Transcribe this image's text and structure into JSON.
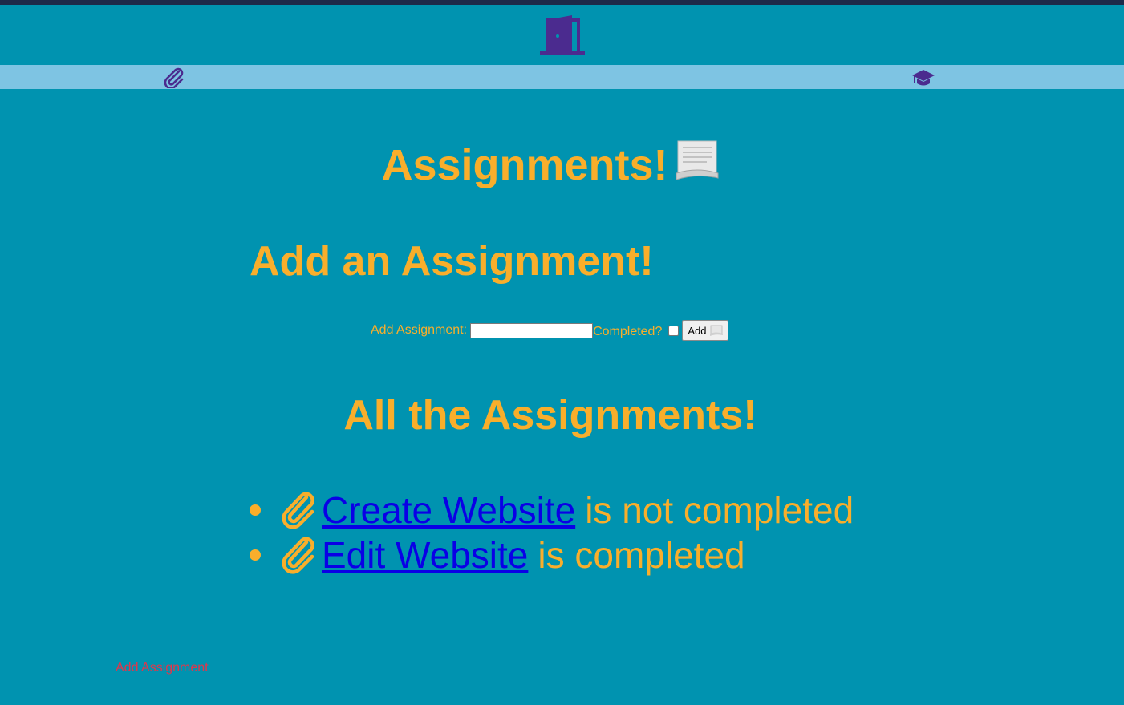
{
  "header": {
    "logout_icon": "door-icon"
  },
  "nav": {
    "left_icon": "paperclip-icon",
    "right_icon": "graduation-cap-icon"
  },
  "main": {
    "title": "Assignments!",
    "title_emoji": "scroll-icon",
    "add_heading": "Add an Assignment!",
    "form": {
      "label": "Add Assignment:",
      "input_value": "",
      "completed_label": "Completed?",
      "completed_checked": false,
      "button_label": "Add"
    },
    "all_heading": "All the Assignments!",
    "assignments": [
      {
        "name": "Create Website",
        "status": "is not completed"
      },
      {
        "name": "Edit Website",
        "status": "is completed"
      }
    ]
  },
  "footer": {
    "link": "Add Assignment"
  },
  "colors": {
    "background": "#0093b0",
    "nav_bar": "#7ec4e3",
    "accent": "#f9ae2b",
    "link": "#0a00e6",
    "icon_purple": "#4b2b8f",
    "footer_link": "#e2354a"
  }
}
